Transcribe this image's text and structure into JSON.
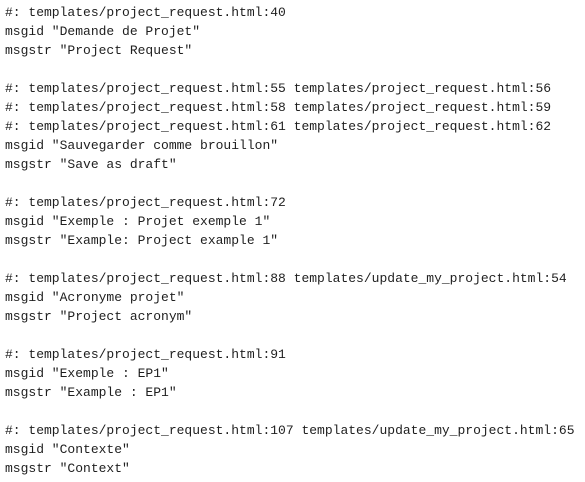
{
  "entries": [
    {
      "refs": [
        "#: templates/project_request.html:40"
      ],
      "msgid": "msgid \"Demande de Projet\"",
      "msgstr": "msgstr \"Project Request\""
    },
    {
      "refs": [
        "#: templates/project_request.html:55 templates/project_request.html:56",
        "#: templates/project_request.html:58 templates/project_request.html:59",
        "#: templates/project_request.html:61 templates/project_request.html:62"
      ],
      "msgid": "msgid \"Sauvegarder comme brouillon\"",
      "msgstr": "msgstr \"Save as draft\""
    },
    {
      "refs": [
        "#: templates/project_request.html:72"
      ],
      "msgid": "msgid \"Exemple : Projet exemple 1\"",
      "msgstr": "msgstr \"Example: Project example 1\""
    },
    {
      "refs": [
        "#: templates/project_request.html:88 templates/update_my_project.html:54"
      ],
      "msgid": "msgid \"Acronyme projet\"",
      "msgstr": "msgstr \"Project acronym\""
    },
    {
      "refs": [
        "#: templates/project_request.html:91"
      ],
      "msgid": "msgid \"Exemple : EP1\"",
      "msgstr": "msgstr \"Example : EP1\""
    },
    {
      "refs": [
        "#: templates/project_request.html:107 templates/update_my_project.html:65"
      ],
      "msgid": "msgid \"Contexte\"",
      "msgstr": "msgstr \"Context\""
    }
  ]
}
